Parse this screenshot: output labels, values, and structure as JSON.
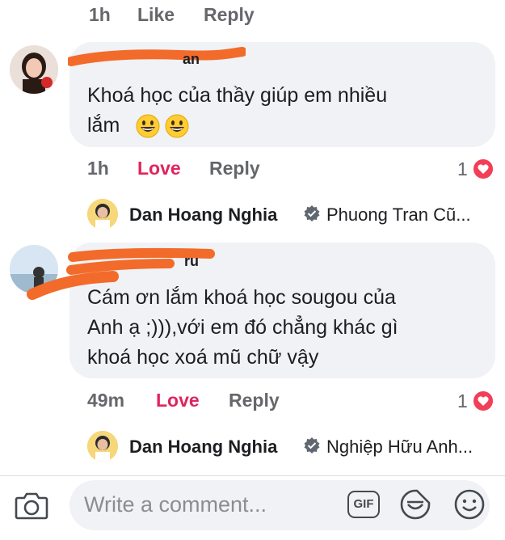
{
  "top_actions": {
    "time": "1h",
    "like": "Like",
    "reply": "Reply"
  },
  "comments": [
    {
      "text_line1": "Khoá học của thầy giúp em nhiều",
      "text_line2": "lắm",
      "name_partial": "an",
      "time": "1h",
      "love": "Love",
      "reply": "Reply",
      "reaction_count": "1",
      "reply_preview": {
        "author": "Dan Hoang Nghia",
        "snippet": "Phuong Tran  Cũ..."
      }
    },
    {
      "text_line1": "Cám ơn lắm khoá học sougou của",
      "text_line2": "Anh ạ ;))),với em đó chẳng khác gì",
      "text_line3": "khoá học xoá mũ chữ vậy",
      "name_partial": "ru",
      "time": "49m",
      "love": "Love",
      "reply": "Reply",
      "reaction_count": "1",
      "reply_preview": {
        "author": "Dan Hoang Nghia",
        "snippet": "Nghiệp Hữu Anh..."
      }
    }
  ],
  "composer": {
    "placeholder": "Write a comment...",
    "gif_label": "GIF"
  },
  "colors": {
    "love": "#e0245e",
    "bubble": "#f0f2f5",
    "scribble": "#f26b2a",
    "meta": "#65676b"
  }
}
